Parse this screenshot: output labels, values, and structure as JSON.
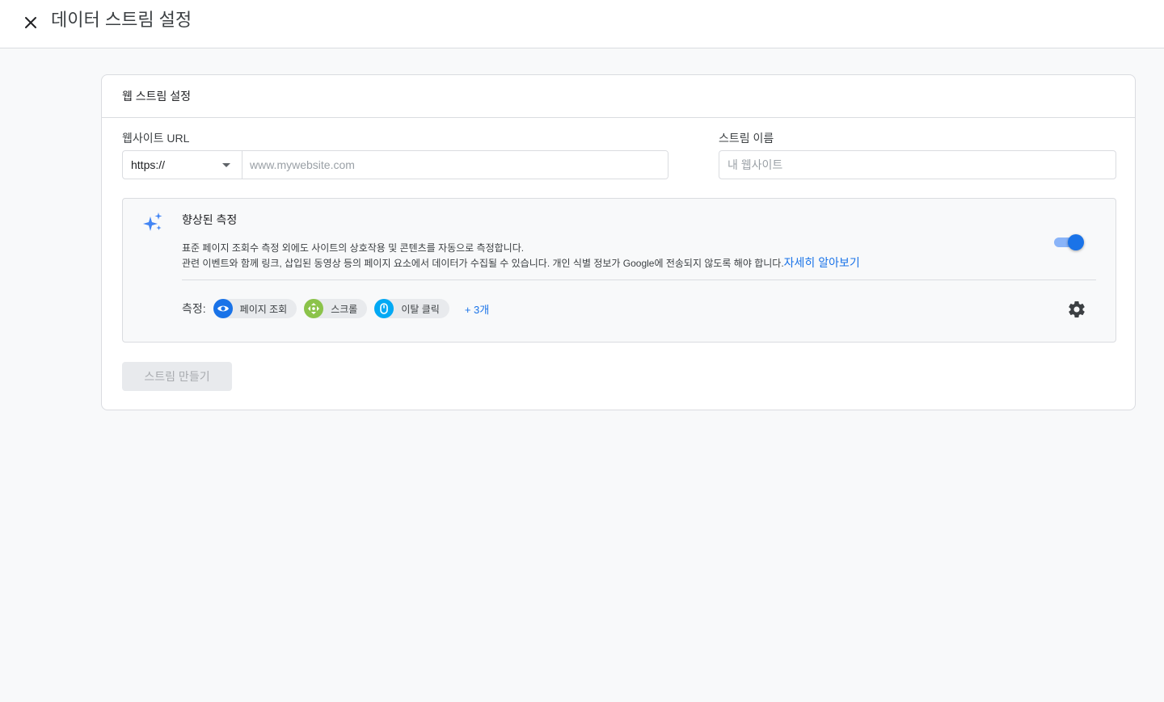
{
  "header": {
    "title": "데이터 스트림 설정"
  },
  "card": {
    "title": "웹 스트림 설정",
    "url_label": "웹사이트 URL",
    "protocol_value": "https://",
    "url_placeholder": "www.mywebsite.com",
    "name_label": "스트림 이름",
    "name_placeholder": "내 웹사이트"
  },
  "enhanced": {
    "title": "향상된 측정",
    "desc_line1": "표준 페이지 조회수 측정 외에도 사이트의 상호작용 및 콘텐츠를 자동으로 측정합니다.",
    "desc_line2": "관련 이벤트와 함께 링크, 삽입된 동영상 등의 페이지 요소에서 데이터가 수집될 수 있습니다. 개인 식별 정보가 Google에 전송되지 않도록 해야 합니다.",
    "learn_more": "자세히 알아보기",
    "toggle_on": true,
    "measure_label": "측정:",
    "chips": [
      {
        "label": "페이지 조회",
        "icon": "eye-icon",
        "color": "#1a73e8"
      },
      {
        "label": "스크롤",
        "icon": "scroll-arrows-icon",
        "color": "#8bc34a"
      },
      {
        "label": "이탈 클릭",
        "icon": "mouse-icon",
        "color": "#03a9f4"
      }
    ],
    "more": "+ 3개"
  },
  "actions": {
    "create_label": "스트림 만들기"
  },
  "colors": {
    "accent": "#1a73e8",
    "disabled_bg": "#e8eaed",
    "disabled_text": "#a8abaf"
  }
}
